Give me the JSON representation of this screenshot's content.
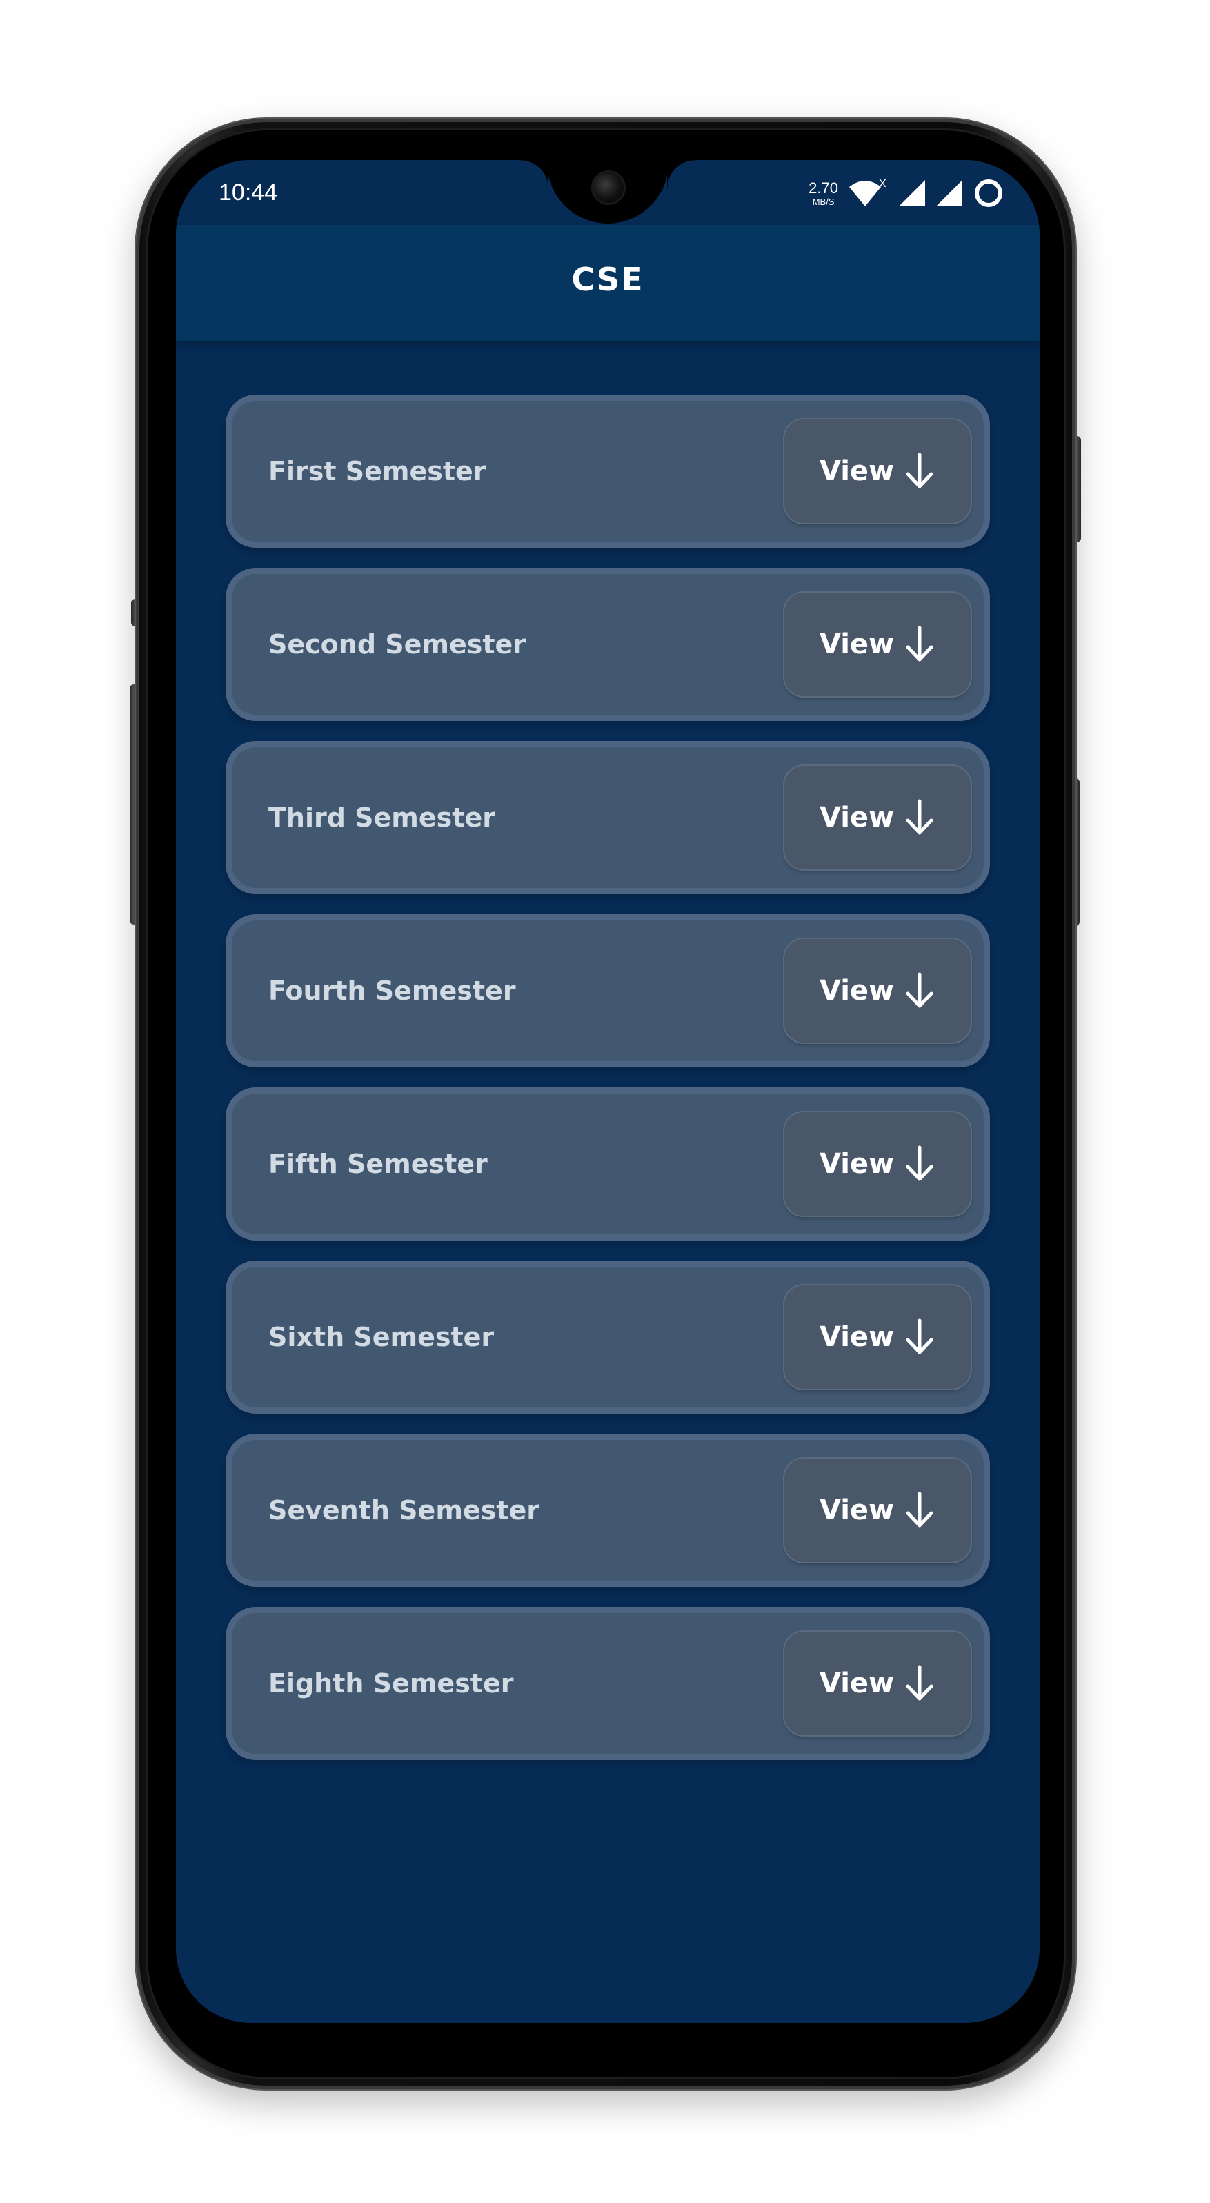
{
  "status_bar": {
    "time": "10:44",
    "speed_value": "2.70",
    "speed_unit": "MB/S",
    "wifi_badge": "X",
    "icons": [
      "wifi-icon",
      "cell-signal-icon",
      "cell-signal-icon",
      "loading-ring-icon"
    ]
  },
  "app_bar": {
    "title": "CSE"
  },
  "semesters": [
    {
      "label": "First Semester",
      "button": "View"
    },
    {
      "label": "Second Semester",
      "button": "View"
    },
    {
      "label": "Third Semester",
      "button": "View"
    },
    {
      "label": "Fourth Semester",
      "button": "View"
    },
    {
      "label": "Fifth Semester",
      "button": "View"
    },
    {
      "label": "Sixth Semester",
      "button": "View"
    },
    {
      "label": "Seventh Semester",
      "button": "View"
    },
    {
      "label": "Eighth Semester",
      "button": "View"
    }
  ],
  "colors": {
    "background": "#062b55",
    "app_bar": "#04365f",
    "card": "#425870",
    "card_border": "#4d6583",
    "button": "#4a5769",
    "label_text": "#d2dae4",
    "button_text": "#ffffff"
  },
  "button_icon": "arrow-down-icon"
}
